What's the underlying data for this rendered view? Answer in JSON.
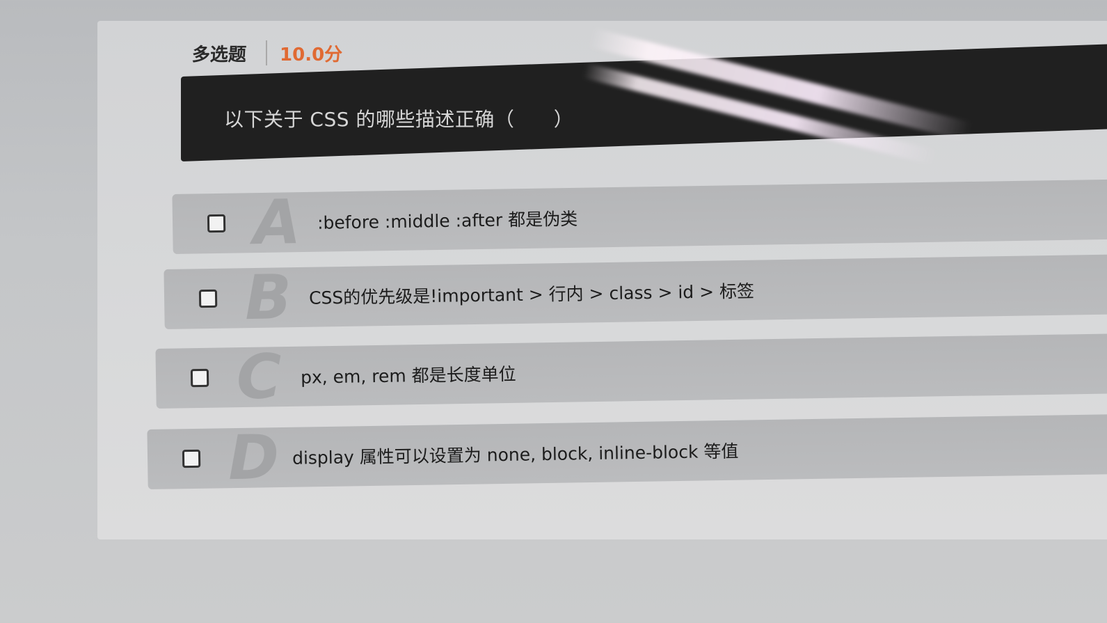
{
  "question": {
    "type_label": "多选题",
    "score": "10.0分",
    "stem": "以下关于 CSS 的哪些描述正确（      ）"
  },
  "options": [
    {
      "letter": "A",
      "text": ":before :middle :after 都是伪类",
      "checked": false
    },
    {
      "letter": "B",
      "text": "CSS的优先级是!important > 行内 > class > id > 标签",
      "checked": false
    },
    {
      "letter": "C",
      "text": "px, em, rem 都是长度单位",
      "checked": false
    },
    {
      "letter": "D",
      "text": "display 属性可以设置为 none, block, inline-block 等值",
      "checked": false
    }
  ],
  "colors": {
    "score": "#e06a33",
    "question_bar": "#202020"
  }
}
